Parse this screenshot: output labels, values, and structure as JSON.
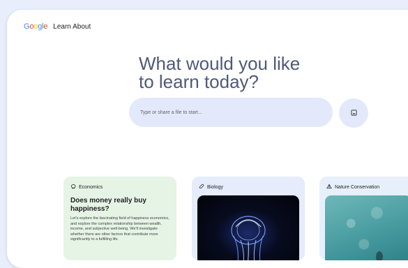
{
  "header": {
    "logo_letters": [
      "G",
      "o",
      "o",
      "g",
      "l",
      "e"
    ],
    "product_name": "Learn About"
  },
  "hero": {
    "line1": "What would you like",
    "line2": "to learn today?"
  },
  "search": {
    "placeholder": "Type or share a file to start..."
  },
  "upload": {
    "icon": "image-upload-icon"
  },
  "cards": [
    {
      "topic": "Economics",
      "topic_icon": "piggy-bank-icon",
      "title": "Does money really buy happiness?",
      "body": "Let's explore the fascinating field of happiness economics, and explore the complex relationship between wealth, income, and subjective well-being. We'll investigate whether there are other factors that contribute more significantly to a fulfilling life.",
      "background": "#e6f4e5"
    },
    {
      "topic": "Biology",
      "topic_icon": "bandage-icon",
      "image": "jellyfish-image",
      "background": "#e6ecfb"
    },
    {
      "topic": "Nature Conservation",
      "topic_icon": "tent-icon",
      "image": "ocean-water-image",
      "background": "#e7f0fa"
    }
  ],
  "colors": {
    "page_background": "#e8eefb",
    "hero_text": "#50597a",
    "search_background": "#e3e9fb"
  }
}
